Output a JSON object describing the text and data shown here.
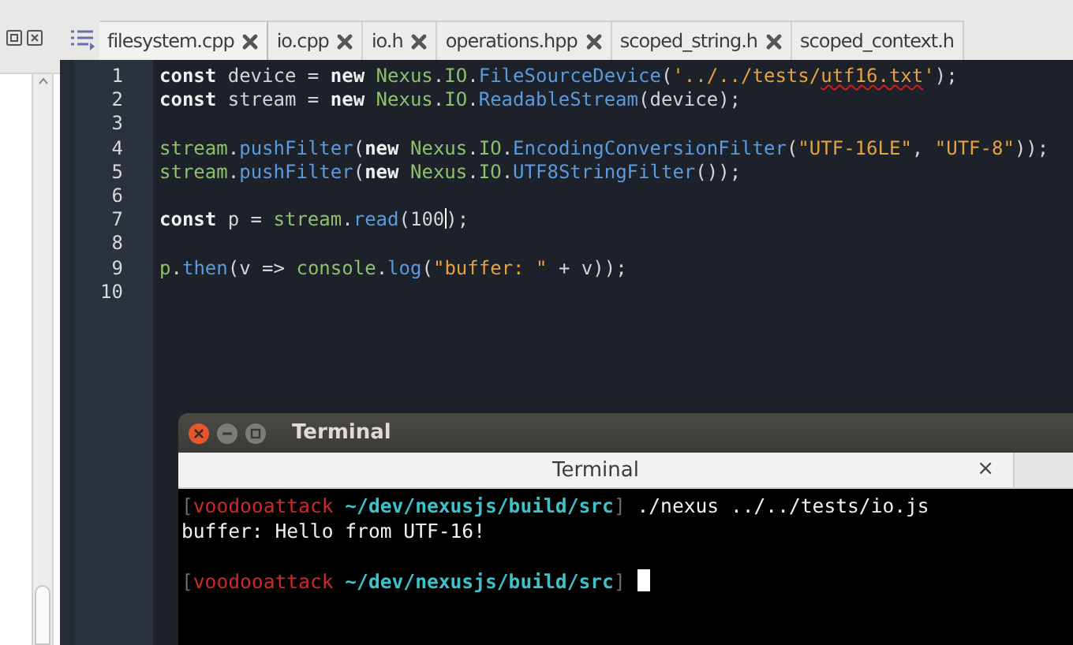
{
  "tabs": [
    {
      "label": "filesystem.cpp",
      "selected": true,
      "closable": true
    },
    {
      "label": "io.cpp",
      "selected": false,
      "closable": true
    },
    {
      "label": "io.h",
      "selected": false,
      "closable": true
    },
    {
      "label": "operations.hpp",
      "selected": false,
      "closable": true
    },
    {
      "label": "scoped_string.h",
      "selected": false,
      "closable": true
    },
    {
      "label": "scoped_context.h",
      "selected": false,
      "closable": false
    }
  ],
  "editor": {
    "lines": [
      {
        "number": "1",
        "tokens": [
          {
            "kind": "keyword",
            "text": "const"
          },
          {
            "kind": "plain",
            "text": " device = "
          },
          {
            "kind": "keyword",
            "text": "new"
          },
          {
            "kind": "ident",
            "text": " Nexus"
          },
          {
            "kind": "plain",
            "text": "."
          },
          {
            "kind": "ident",
            "text": "IO"
          },
          {
            "kind": "plain",
            "text": "."
          },
          {
            "kind": "method",
            "text": "FileSourceDevice"
          },
          {
            "kind": "plain",
            "text": "("
          },
          {
            "kind": "string",
            "text": "'../../tests/"
          },
          {
            "kind": "string",
            "text": "utf16.txt",
            "misspelled": true
          },
          {
            "kind": "string",
            "text": "'"
          },
          {
            "kind": "plain",
            "text": ");"
          }
        ]
      },
      {
        "number": "2",
        "tokens": [
          {
            "kind": "keyword",
            "text": "const"
          },
          {
            "kind": "plain",
            "text": " stream = "
          },
          {
            "kind": "keyword",
            "text": "new"
          },
          {
            "kind": "ident",
            "text": " Nexus"
          },
          {
            "kind": "plain",
            "text": "."
          },
          {
            "kind": "ident",
            "text": "IO"
          },
          {
            "kind": "plain",
            "text": "."
          },
          {
            "kind": "method",
            "text": "ReadableStream"
          },
          {
            "kind": "plain",
            "text": "(device);"
          }
        ]
      },
      {
        "number": "3"
      },
      {
        "number": "4",
        "tokens": [
          {
            "kind": "ident",
            "text": "stream"
          },
          {
            "kind": "plain",
            "text": "."
          },
          {
            "kind": "method",
            "text": "pushFilter"
          },
          {
            "kind": "plain",
            "text": "("
          },
          {
            "kind": "keyword",
            "text": "new"
          },
          {
            "kind": "ident",
            "text": " Nexus"
          },
          {
            "kind": "plain",
            "text": "."
          },
          {
            "kind": "ident",
            "text": "IO"
          },
          {
            "kind": "plain",
            "text": "."
          },
          {
            "kind": "method",
            "text": "EncodingConversionFilter"
          },
          {
            "kind": "plain",
            "text": "("
          },
          {
            "kind": "string",
            "text": "\"UTF-16LE\""
          },
          {
            "kind": "plain",
            "text": ", "
          },
          {
            "kind": "string",
            "text": "\"UTF-8\""
          },
          {
            "kind": "plain",
            "text": "));"
          }
        ]
      },
      {
        "number": "5",
        "tokens": [
          {
            "kind": "ident",
            "text": "stream"
          },
          {
            "kind": "plain",
            "text": "."
          },
          {
            "kind": "method",
            "text": "pushFilter"
          },
          {
            "kind": "plain",
            "text": "("
          },
          {
            "kind": "keyword",
            "text": "new"
          },
          {
            "kind": "ident",
            "text": " Nexus"
          },
          {
            "kind": "plain",
            "text": "."
          },
          {
            "kind": "ident",
            "text": "IO"
          },
          {
            "kind": "plain",
            "text": "."
          },
          {
            "kind": "method",
            "text": "UTF8StringFilter"
          },
          {
            "kind": "plain",
            "text": "());"
          }
        ]
      },
      {
        "number": "6"
      },
      {
        "number": "7",
        "tokens": [
          {
            "kind": "keyword",
            "text": "const"
          },
          {
            "kind": "plain",
            "text": " p = "
          },
          {
            "kind": "ident",
            "text": "stream"
          },
          {
            "kind": "plain",
            "text": "."
          },
          {
            "kind": "method",
            "text": "read"
          },
          {
            "kind": "plain",
            "text": "("
          },
          {
            "kind": "number",
            "text": "100"
          },
          {
            "kind": "plain",
            "text": ");",
            "caret_before": true
          }
        ]
      },
      {
        "number": "8"
      },
      {
        "number": "9",
        "tokens": [
          {
            "kind": "ident",
            "text": "p"
          },
          {
            "kind": "plain",
            "text": "."
          },
          {
            "kind": "method",
            "text": "then"
          },
          {
            "kind": "plain",
            "text": "(v => "
          },
          {
            "kind": "ident",
            "text": "console"
          },
          {
            "kind": "plain",
            "text": "."
          },
          {
            "kind": "method",
            "text": "log"
          },
          {
            "kind": "plain",
            "text": "("
          },
          {
            "kind": "string",
            "text": "\"buffer: \""
          },
          {
            "kind": "plain",
            "text": " + v));"
          }
        ]
      },
      {
        "number": "10"
      }
    ]
  },
  "terminal": {
    "title": "Terminal",
    "tab": {
      "label": "Terminal",
      "close": "×"
    },
    "lines": [
      {
        "cursor": false,
        "segments": [
          {
            "kind": "bracket",
            "text": "["
          },
          {
            "kind": "user",
            "text": "voodooattack"
          },
          {
            "kind": "path",
            "text": " ~/dev/nexusjs/build/src"
          },
          {
            "kind": "bracket",
            "text": "]"
          },
          {
            "kind": "plain",
            "text": " ./nexus ../../tests/io.js"
          }
        ]
      },
      {
        "cursor": false,
        "segments": [
          {
            "kind": "plain",
            "text": "buffer: Hello from UTF-16!"
          }
        ]
      },
      {
        "cursor": false
      },
      {
        "cursor": true,
        "segments": [
          {
            "kind": "bracket",
            "text": "["
          },
          {
            "kind": "user",
            "text": "voodooattack"
          },
          {
            "kind": "path",
            "text": " ~/dev/nexusjs/build/src"
          },
          {
            "kind": "bracket",
            "text": "]"
          }
        ]
      }
    ]
  }
}
